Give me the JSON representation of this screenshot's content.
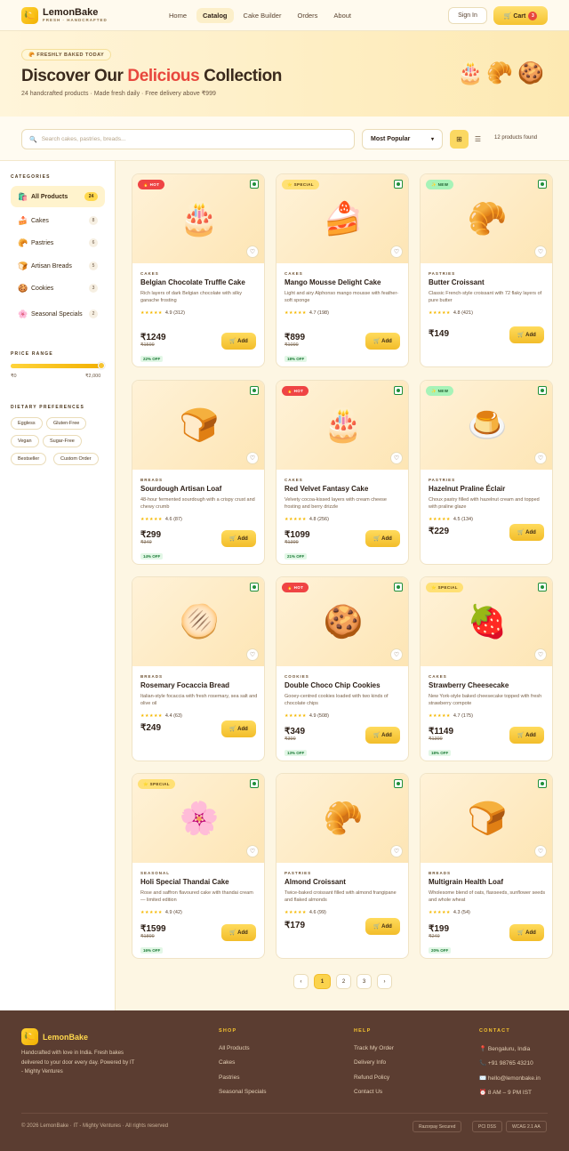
{
  "header": {
    "brand": "LemonBake",
    "tagline": "FRESH · HANDCRAFTED",
    "nav": [
      "Home",
      "Catalog",
      "Cake Builder",
      "Orders",
      "About"
    ],
    "sign_in": "Sign In",
    "cart_label": "🛒 Cart",
    "cart_count": "3"
  },
  "hero": {
    "badge": "🥐 FRESHLY BAKED TODAY",
    "title_a": "Discover Our ",
    "title_accent": "Delicious",
    "title_b": " Collection",
    "subtitle": "24 handcrafted products · Made fresh daily · Free delivery above ₹999",
    "emojis": [
      "🎂",
      "🥐",
      "🍪"
    ]
  },
  "toolbar": {
    "search_placeholder": "Search cakes, pastries, breads...",
    "sort_value": "Most Popular",
    "count": "12 products found"
  },
  "sidebar": {
    "categories_title": "CATEGORIES",
    "categories": [
      {
        "icon": "🛍️",
        "label": "All Products",
        "count": "24"
      },
      {
        "icon": "🍰",
        "label": "Cakes",
        "count": "8"
      },
      {
        "icon": "🥐",
        "label": "Pastries",
        "count": "6"
      },
      {
        "icon": "🍞",
        "label": "Artisan Breads",
        "count": "5"
      },
      {
        "icon": "🍪",
        "label": "Cookies",
        "count": "3"
      },
      {
        "icon": "🌸",
        "label": "Seasonal Specials",
        "count": "2"
      }
    ],
    "price_title": "PRICE RANGE",
    "price_min": "₹0",
    "price_max": "₹2,000",
    "price_fill": 1.0,
    "dietary_title": "DIETARY PREFERENCES",
    "chips": [
      "Eggless",
      "Gluten-Free",
      "Vegan",
      "Sugar-Free",
      "Bestseller",
      "Custom Order"
    ]
  },
  "products": [
    {
      "emoji": "🎂",
      "badge": "🔥 HOT",
      "badge_type": "hot",
      "category": "CAKES",
      "name": "Belgian Chocolate Truffle Cake",
      "desc": "Rich layers of dark Belgian chocolate with silky ganache frosting",
      "stars": "★★★★★",
      "rating": "4.9 (312)",
      "price": "₹1249",
      "old": "₹1599",
      "off": "22% OFF"
    },
    {
      "emoji": "🍰",
      "badge": "⭐ SPECIAL",
      "badge_type": "special",
      "category": "CAKES",
      "name": "Mango Mousse Delight Cake",
      "desc": "Light and airy Alphonso mango mousse with feather-soft sponge",
      "stars": "★★★★★",
      "rating": "4.7 (198)",
      "price": "₹899",
      "old": "₹1099",
      "off": "18% OFF"
    },
    {
      "emoji": "🥐",
      "badge": "✨ NEW",
      "badge_type": "new",
      "category": "PASTRIES",
      "name": "Butter Croissant",
      "desc": "Classic French-style croissant with 72 flaky layers of pure butter",
      "stars": "★★★★★",
      "rating": "4.8 (421)",
      "price": "₹149",
      "old": "",
      "off": ""
    },
    {
      "emoji": "🍞",
      "badge": "",
      "badge_type": "",
      "category": "BREADS",
      "name": "Sourdough Artisan Loaf",
      "desc": "48-hour fermented sourdough with a crispy crust and chewy crumb",
      "stars": "★★★★★",
      "rating": "4.6 (87)",
      "price": "₹299",
      "old": "₹349",
      "off": "14% OFF"
    },
    {
      "emoji": "🎂",
      "badge": "🔥 HOT",
      "badge_type": "hot",
      "category": "CAKES",
      "name": "Red Velvet Fantasy Cake",
      "desc": "Velvety cocoa-kissed layers with cream cheese frosting and berry drizzle",
      "stars": "★★★★★",
      "rating": "4.8 (256)",
      "price": "₹1099",
      "old": "₹1399",
      "off": "21% OFF"
    },
    {
      "emoji": "🍮",
      "badge": "✨ NEW",
      "badge_type": "new",
      "category": "PASTRIES",
      "name": "Hazelnut Praline Éclair",
      "desc": "Choux pastry filled with hazelnut cream and topped with praline glaze",
      "stars": "★★★★★",
      "rating": "4.5 (134)",
      "price": "₹229",
      "old": "",
      "off": ""
    },
    {
      "emoji": "🫓",
      "badge": "",
      "badge_type": "",
      "category": "BREADS",
      "name": "Rosemary Focaccia Bread",
      "desc": "Italian-style focaccia with fresh rosemary, sea salt and olive oil",
      "stars": "★★★★★",
      "rating": "4.4 (63)",
      "price": "₹249",
      "old": "",
      "off": ""
    },
    {
      "emoji": "🍪",
      "badge": "🔥 HOT",
      "badge_type": "hot",
      "category": "COOKIES",
      "name": "Double Choco Chip Cookies",
      "desc": "Gooey-centred cookies loaded with two kinds of chocolate chips",
      "stars": "★★★★★",
      "rating": "4.9 (508)",
      "price": "₹349",
      "old": "₹399",
      "off": "13% OFF"
    },
    {
      "emoji": "🍓",
      "badge": "⭐ SPECIAL",
      "badge_type": "special",
      "category": "CAKES",
      "name": "Strawberry Cheesecake",
      "desc": "New York-style baked cheesecake topped with fresh strawberry compote",
      "stars": "★★★★★",
      "rating": "4.7 (175)",
      "price": "₹1149",
      "old": "₹1399",
      "off": "18% OFF"
    },
    {
      "emoji": "🌸",
      "badge": "⭐ SPECIAL",
      "badge_type": "special",
      "category": "SEASONAL",
      "name": "Holi Special Thandai Cake",
      "desc": "Rose and saffron flavoured cake with thandai cream — limited edition",
      "stars": "★★★★★",
      "rating": "4.9 (42)",
      "price": "₹1599",
      "old": "₹1899",
      "off": "16% OFF"
    },
    {
      "emoji": "🥐",
      "badge": "",
      "badge_type": "",
      "category": "PASTRIES",
      "name": "Almond Croissant",
      "desc": "Twice-baked croissant filled with almond frangipane and flaked almonds",
      "stars": "★★★★★",
      "rating": "4.6 (99)",
      "price": "₹179",
      "old": "",
      "off": ""
    },
    {
      "emoji": "🍞",
      "badge": "",
      "badge_type": "",
      "category": "BREADS",
      "name": "Multigrain Health Loaf",
      "desc": "Wholesome blend of oats, flaxseeds, sunflower seeds and whole wheat",
      "stars": "★★★★★",
      "rating": "4.3 (54)",
      "price": "₹199",
      "old": "₹249",
      "off": "20% OFF"
    }
  ],
  "add_label": "🛒 Add",
  "pagination": [
    "‹",
    "1",
    "2",
    "3",
    "›"
  ],
  "footer": {
    "brand": "LemonBake",
    "about": "Handcrafted with love in India. Fresh bakes delivered to your door every day. Powered by IT - Mighty Ventures",
    "shop_title": "SHOP",
    "shop": [
      "All Products",
      "Cakes",
      "Pastries",
      "Seasonal Specials"
    ],
    "help_title": "HELP",
    "help": [
      "Track My Order",
      "Delivery Info",
      "Refund Policy",
      "Contact Us"
    ],
    "contact_title": "CONTACT",
    "contact": [
      "📍 Bengaluru, India",
      "📞 +91 98765 43210",
      "✉️ hello@lemonbake.in",
      "⏰ 8 AM – 9 PM IST"
    ],
    "copyright": "© 2026 LemonBake · IT - Mighty Ventures · All rights reserved",
    "badges": [
      "Razorpay Secured",
      "PCI DSS",
      "WCAG 2.1 AA"
    ]
  },
  "colors": {
    "accent": "#f5c330",
    "hot": "#ef4444",
    "footer_bg": "#5b3d31",
    "title_accent": "#e8473d"
  }
}
